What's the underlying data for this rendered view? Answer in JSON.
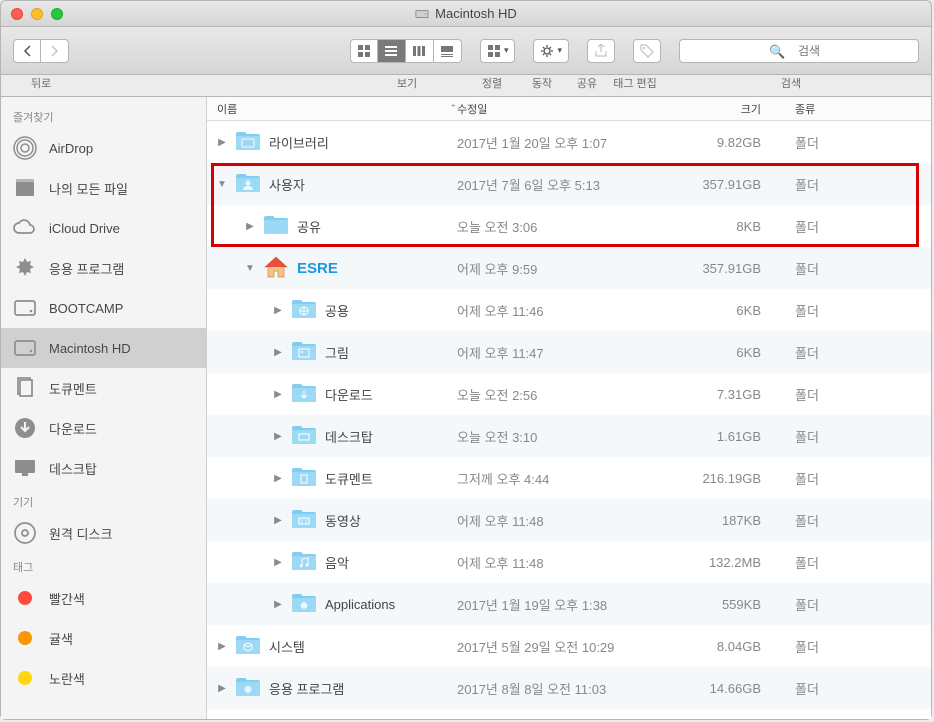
{
  "window": {
    "title": "Macintosh HD"
  },
  "toolbar": {
    "back_label": "뒤로",
    "view_label": "보기",
    "sort_label": "정렬",
    "action_label": "동작",
    "share_label": "공유",
    "tagedit_label": "태그 편집",
    "search_label": "검색",
    "search_placeholder": "검색"
  },
  "sidebar": {
    "sections": [
      {
        "heading": "즐겨찾기",
        "items": [
          {
            "label": "AirDrop",
            "icon": "airdrop"
          },
          {
            "label": "나의 모든 파일",
            "icon": "allfiles"
          },
          {
            "label": "iCloud Drive",
            "icon": "cloud"
          },
          {
            "label": "응용 프로그램",
            "icon": "apps"
          },
          {
            "label": "BOOTCAMP",
            "icon": "hd"
          },
          {
            "label": "Macintosh HD",
            "icon": "hd",
            "selected": true
          },
          {
            "label": "도큐멘트",
            "icon": "docs"
          },
          {
            "label": "다운로드",
            "icon": "downloads"
          },
          {
            "label": "데스크탑",
            "icon": "desktop"
          }
        ]
      },
      {
        "heading": "기기",
        "items": [
          {
            "label": "원격 디스크",
            "icon": "disc"
          }
        ]
      },
      {
        "heading": "태그",
        "items": [
          {
            "label": "빨간색",
            "color": "#ff4b3e"
          },
          {
            "label": "귤색",
            "color": "#ff9500"
          },
          {
            "label": "노란색",
            "color": "#ffd60a"
          }
        ]
      }
    ]
  },
  "columns": {
    "name": "이름",
    "date": "수정일",
    "size": "크기",
    "kind": "종류"
  },
  "rows": [
    {
      "indent": 0,
      "arrow": "right",
      "icon": "folder-sys",
      "name": "라이브러리",
      "date": "2017년 1월 20일 오후 1:07",
      "size": "9.82GB",
      "kind": "폴더"
    },
    {
      "indent": 0,
      "arrow": "down",
      "icon": "folder-users",
      "name": "사용자",
      "date": "2017년 7월 6일 오후 5:13",
      "size": "357.91GB",
      "kind": "폴더",
      "hl": true
    },
    {
      "indent": 1,
      "arrow": "right",
      "icon": "folder",
      "name": "공유",
      "date": "오늘 오전 3:06",
      "size": "8KB",
      "kind": "폴더",
      "hl": true
    },
    {
      "indent": 1,
      "arrow": "down",
      "icon": "home",
      "name": "ESRE",
      "date": "어제 오후 9:59",
      "size": "357.91GB",
      "kind": "폴더",
      "esre": true
    },
    {
      "indent": 2,
      "arrow": "right",
      "icon": "folder-public",
      "name": "공용",
      "date": "어제 오후 11:46",
      "size": "6KB",
      "kind": "폴더"
    },
    {
      "indent": 2,
      "arrow": "right",
      "icon": "folder-pics",
      "name": "그림",
      "date": "어제 오후 11:47",
      "size": "6KB",
      "kind": "폴더"
    },
    {
      "indent": 2,
      "arrow": "right",
      "icon": "folder-down",
      "name": "다운로드",
      "date": "오늘 오전 2:56",
      "size": "7.31GB",
      "kind": "폴더"
    },
    {
      "indent": 2,
      "arrow": "right",
      "icon": "folder-desk",
      "name": "데스크탑",
      "date": "오늘 오전 3:10",
      "size": "1.61GB",
      "kind": "폴더"
    },
    {
      "indent": 2,
      "arrow": "right",
      "icon": "folder-docs",
      "name": "도큐멘트",
      "date": "그저께 오후 4:44",
      "size": "216.19GB",
      "kind": "폴더"
    },
    {
      "indent": 2,
      "arrow": "right",
      "icon": "folder-mov",
      "name": "동영상",
      "date": "어제 오후 11:48",
      "size": "187KB",
      "kind": "폴더"
    },
    {
      "indent": 2,
      "arrow": "right",
      "icon": "folder-music",
      "name": "음악",
      "date": "어제 오후 11:48",
      "size": "132.2MB",
      "kind": "폴더"
    },
    {
      "indent": 2,
      "arrow": "right",
      "icon": "folder-apps",
      "name": "Applications",
      "date": "2017년 1월 19일 오후 1:38",
      "size": "559KB",
      "kind": "폴더"
    },
    {
      "indent": 0,
      "arrow": "right",
      "icon": "folder-sys2",
      "name": "시스템",
      "date": "2017년 5월 29일 오전 10:29",
      "size": "8.04GB",
      "kind": "폴더"
    },
    {
      "indent": 0,
      "arrow": "right",
      "icon": "folder-apps2",
      "name": "응용 프로그램",
      "date": "2017년 8월 8일 오전 11:03",
      "size": "14.66GB",
      "kind": "폴더"
    }
  ]
}
